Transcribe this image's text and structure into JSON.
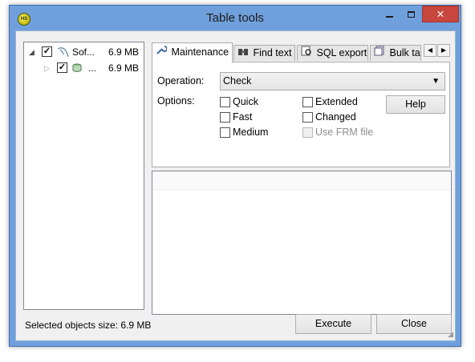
{
  "window": {
    "title": "Table tools",
    "app_icon_text": "HS"
  },
  "tree": {
    "nodes": [
      {
        "label": "Sof...",
        "size": "6.9 MB",
        "checked": true
      },
      {
        "label": "...",
        "size": "6.9 MB",
        "checked": true
      }
    ]
  },
  "tabs": [
    {
      "label": "Maintenance",
      "icon": "wrench-icon",
      "active": true
    },
    {
      "label": "Find text",
      "icon": "binoculars-icon"
    },
    {
      "label": "SQL export",
      "icon": "sql-export-icon"
    },
    {
      "label": "Bulk ta",
      "icon": "bulk-table-icon"
    }
  ],
  "maintenance": {
    "operation_label": "Operation:",
    "operation_value": "Check",
    "options_label": "Options:",
    "options": {
      "quick": "Quick",
      "fast": "Fast",
      "medium": "Medium",
      "extended": "Extended",
      "changed": "Changed",
      "use_frm": "Use FRM file"
    },
    "help_label": "Help"
  },
  "status": {
    "selected_size": "Selected objects size: 6.9 MB"
  },
  "buttons": {
    "execute": "Execute",
    "close": "Close"
  }
}
